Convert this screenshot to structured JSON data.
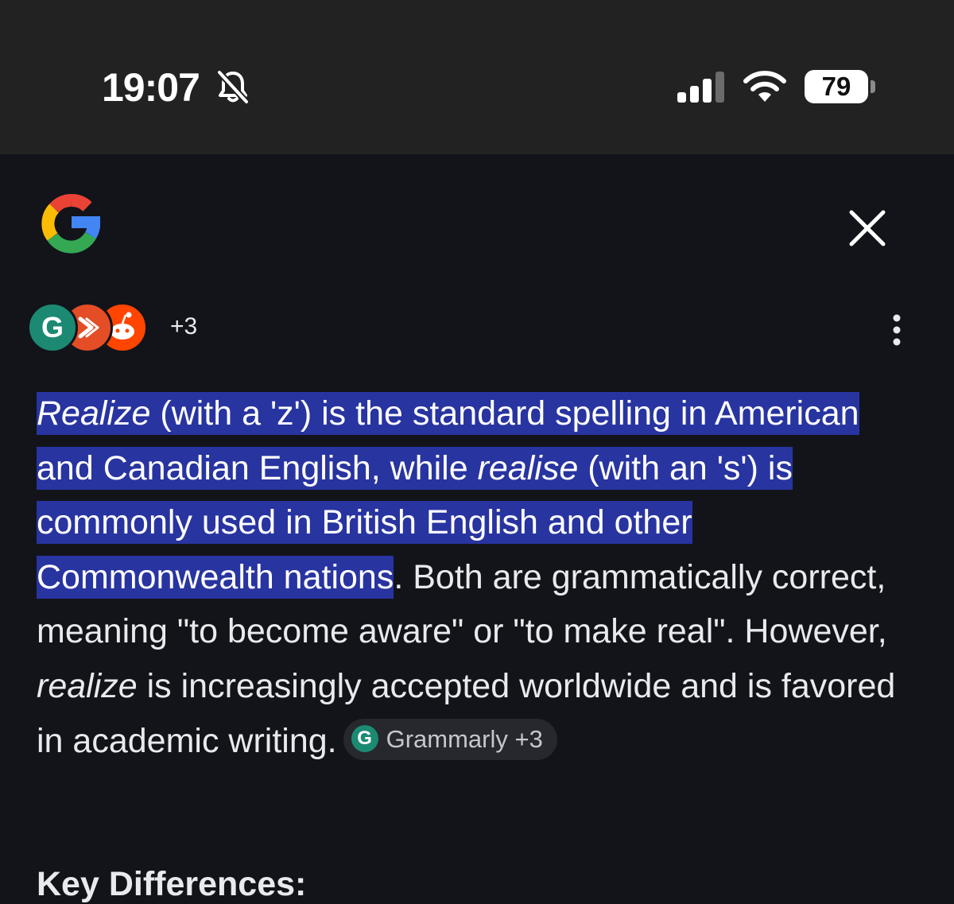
{
  "status_bar": {
    "time": "19:07",
    "battery_level": "79"
  },
  "panel": {
    "sources_more": "+3",
    "answer": {
      "part1_italic": "Realize",
      "part1": " (with a 'z') is the standard spelling in American and Canadian English, while ",
      "part2_italic": "realise",
      "part2": " (with an 's') is commonly used in British English and other Commonwealth nations",
      "part3": ". Both are grammatically correct, meaning \"to become aware\" or \"to make real\". However, ",
      "part4_italic": "realize",
      "part4": " is increasingly accepted worldwide and is favored in academic writing."
    },
    "citation_chip": "Grammarly +3",
    "section_heading": "Key Differences:"
  },
  "colors": {
    "highlight": "#2834a0",
    "background": "#12141a",
    "status_bar": "#222222"
  }
}
